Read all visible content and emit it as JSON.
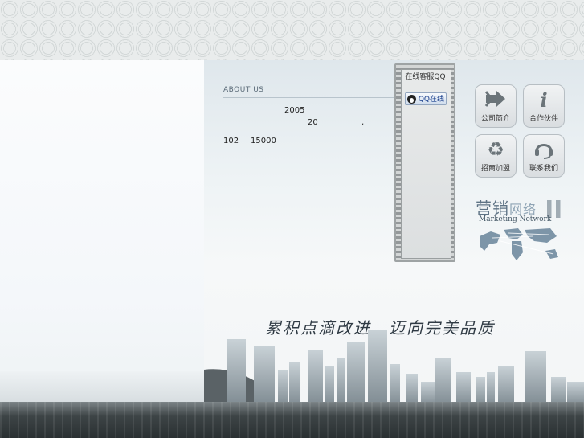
{
  "about": {
    "label": "ABOUT US",
    "line1_num": "2005",
    "line2_num": "20",
    "line2_sep": ",",
    "line3_a": "102",
    "line3_b": "15000"
  },
  "qq": {
    "title": "在线客服QQ",
    "online_label": "QQ在线"
  },
  "nav": [
    {
      "label": "公司简介",
      "icon": "arrow-icon"
    },
    {
      "label": "合作伙伴",
      "icon": "info-icon"
    },
    {
      "label": "招商加盟",
      "icon": "recycle-icon"
    },
    {
      "label": "联系我们",
      "icon": "headset-icon"
    }
  ],
  "marketing": {
    "title_dark": "营销",
    "title_light": "网络",
    "subtitle": "Marketing Network"
  },
  "slogan": "累积点滴改进，迈向完美品质",
  "colors": {
    "accent": "#5e7385",
    "link": "#1a3f8c"
  }
}
